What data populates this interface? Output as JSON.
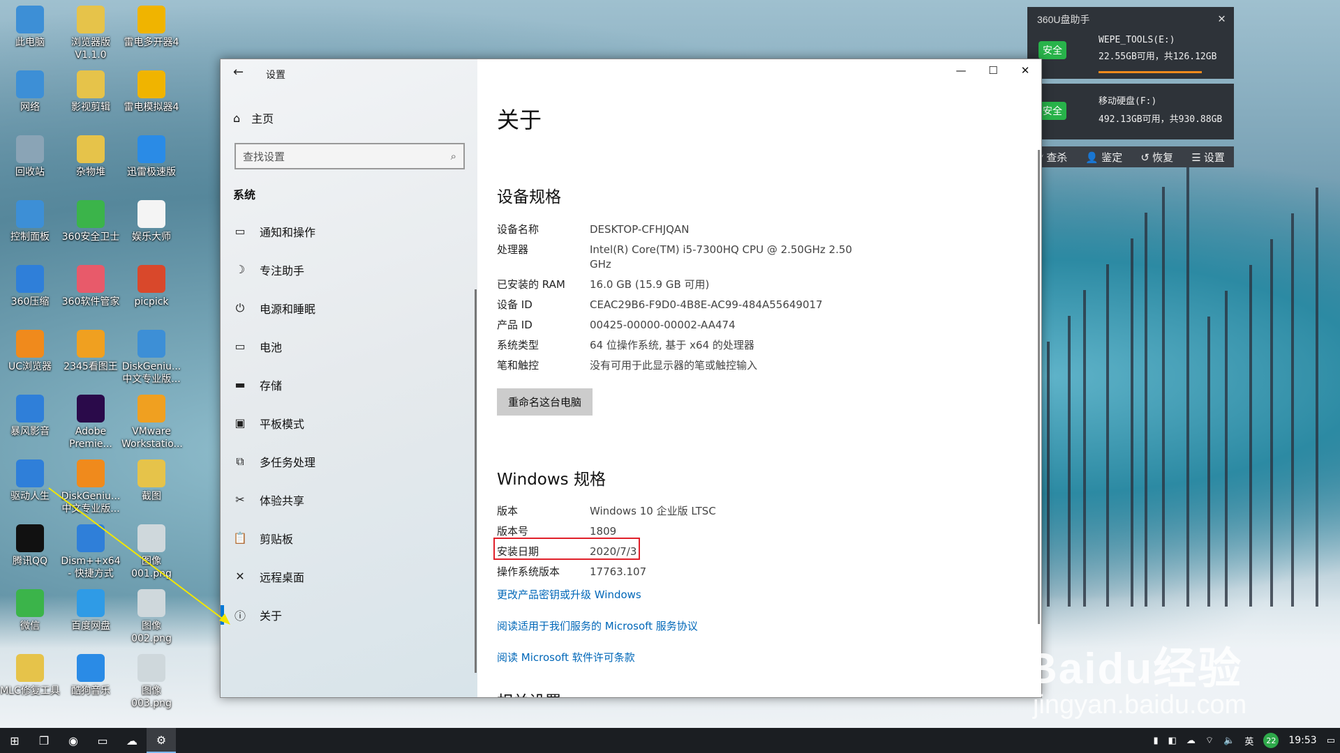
{
  "desktop_icons": [
    {
      "label": "此电脑",
      "icon": "computer-icon",
      "color": "#3d8fd6"
    },
    {
      "label": "浏览器版 V1.1.0",
      "icon": "file-icon",
      "color": "#e6c34a"
    },
    {
      "label": "雷电多开器4",
      "icon": "ldplayer-multi-icon",
      "color": "#f0b400"
    },
    {
      "label": "网络",
      "icon": "network-icon",
      "color": "#3d8fd6"
    },
    {
      "label": "影视剪辑",
      "icon": "folder-icon",
      "color": "#e6c34a"
    },
    {
      "label": "雷电模拟器4",
      "icon": "ldplayer-icon",
      "color": "#f0b400"
    },
    {
      "label": "回收站",
      "icon": "recycle-bin-icon",
      "color": "#8aa4b6"
    },
    {
      "label": "杂物堆",
      "icon": "file-icon",
      "color": "#e6c34a"
    },
    {
      "label": "迅雷极速版",
      "icon": "xunlei-icon",
      "color": "#2a8be6"
    },
    {
      "label": "控制面板",
      "icon": "control-panel-icon",
      "color": "#3d8fd6"
    },
    {
      "label": "360安全卫士",
      "icon": "360-safe-icon",
      "color": "#3bb44a"
    },
    {
      "label": "娱乐大师",
      "icon": "file-icon",
      "color": "#f4f4f4"
    },
    {
      "label": "360压缩",
      "icon": "360-zip-icon",
      "color": "#2f7fd9"
    },
    {
      "label": "360软件管家",
      "icon": "360-software-icon",
      "color": "#e85a6a"
    },
    {
      "label": "picpick",
      "icon": "picpick-icon",
      "color": "#d9482b"
    },
    {
      "label": "UC浏览器",
      "icon": "uc-browser-icon",
      "color": "#f08a1c"
    },
    {
      "label": "2345看图王",
      "icon": "2345-viewer-icon",
      "color": "#f0a020"
    },
    {
      "label": "DiskGeniu... 中文专业版...",
      "icon": "diskgenius-icon",
      "color": "#3d8fd6"
    },
    {
      "label": "暴风影音",
      "icon": "baofeng-icon",
      "color": "#2f7fd9"
    },
    {
      "label": "Adobe Premie...",
      "icon": "premiere-icon",
      "color": "#2a0a4a"
    },
    {
      "label": "VMware Workstatio...",
      "icon": "vmware-icon",
      "color": "#f0a020"
    },
    {
      "label": "驱动人生",
      "icon": "drive-life-icon",
      "color": "#2f7fd9"
    },
    {
      "label": "DiskGeniu... 中文专业版...",
      "icon": "diskgenius-icon",
      "color": "#f08a1c"
    },
    {
      "label": "截图",
      "icon": "folder-icon",
      "color": "#e6c34a"
    },
    {
      "label": "腾讯QQ",
      "icon": "qq-icon",
      "color": "#111111"
    },
    {
      "label": "Dism++x64 - 快捷方式",
      "icon": "dism-icon",
      "color": "#2f7fd9"
    },
    {
      "label": "图像 001.png",
      "icon": "image-file-icon",
      "color": "#cfd8dc"
    },
    {
      "label": "微信",
      "icon": "wechat-icon",
      "color": "#3bb44a"
    },
    {
      "label": "百度网盘",
      "icon": "baidu-pan-icon",
      "color": "#2f9be6"
    },
    {
      "label": "图像 002.png",
      "icon": "image-file-icon",
      "color": "#cfd8dc"
    },
    {
      "label": "MLC修复工具",
      "icon": "file-icon",
      "color": "#e6c34a"
    },
    {
      "label": "酷狗音乐",
      "icon": "kugou-icon",
      "color": "#2a8be6"
    },
    {
      "label": "图像 003.png",
      "icon": "image-file-icon",
      "color": "#cfd8dc"
    }
  ],
  "settings": {
    "app_title": "设置",
    "home_label": "主页",
    "search_placeholder": "查找设置",
    "section_label": "系统",
    "nav": [
      {
        "label": "通知和操作",
        "icon": "notification-icon"
      },
      {
        "label": "专注助手",
        "icon": "moon-icon"
      },
      {
        "label": "电源和睡眠",
        "icon": "power-icon"
      },
      {
        "label": "电池",
        "icon": "battery-icon"
      },
      {
        "label": "存储",
        "icon": "storage-icon"
      },
      {
        "label": "平板模式",
        "icon": "tablet-icon"
      },
      {
        "label": "多任务处理",
        "icon": "multitask-icon"
      },
      {
        "label": "体验共享",
        "icon": "share-icon"
      },
      {
        "label": "剪贴板",
        "icon": "clipboard-icon"
      },
      {
        "label": "远程桌面",
        "icon": "remote-desktop-icon"
      },
      {
        "label": "关于",
        "icon": "info-icon",
        "active": true
      }
    ],
    "page_title": "关于",
    "device_specs_title": "设备规格",
    "device_specs": [
      {
        "key": "设备名称",
        "value": "DESKTOP-CFHJQAN"
      },
      {
        "key": "处理器",
        "value": "Intel(R) Core(TM) i5-7300HQ CPU @ 2.50GHz   2.50 GHz"
      },
      {
        "key": "已安装的 RAM",
        "value": "16.0 GB (15.9 GB 可用)"
      },
      {
        "key": "设备 ID",
        "value": "CEAC29B6-F9D0-4B8E-AC99-484A55649017"
      },
      {
        "key": "产品 ID",
        "value": "00425-00000-00002-AA474"
      },
      {
        "key": "系统类型",
        "value": "64 位操作系统, 基于 x64 的处理器"
      },
      {
        "key": "笔和触控",
        "value": "没有可用于此显示器的笔或触控输入"
      }
    ],
    "rename_button": "重命名这台电脑",
    "windows_specs_title": "Windows 规格",
    "windows_specs": [
      {
        "key": "版本",
        "value": "Windows 10 企业版 LTSC"
      },
      {
        "key": "版本号",
        "value": "1809"
      },
      {
        "key": "安装日期",
        "value": "2020/7/3"
      },
      {
        "key": "操作系统版本",
        "value": "17763.107"
      }
    ],
    "links": [
      "更改产品密钥或升级 Windows",
      "阅读适用于我们服务的 Microsoft 服务协议",
      "阅读 Microsoft 软件许可条款"
    ],
    "cutoff_heading": "相关设置"
  },
  "widget360": {
    "title": "360U盘助手",
    "badge": "安全",
    "drive1_name": "WEPE_TOOLS(E:)",
    "drive1_space": "22.55GB可用，共126.12GB",
    "drive1_used_fraction": 0.82,
    "drive2_name": "移动硬盘(F:)",
    "drive2_space": "492.13GB可用，共930.88GB",
    "tools": [
      "查杀",
      "鉴定",
      "恢复",
      "设置"
    ]
  },
  "taskbar": {
    "time": "19:53",
    "ime": "英",
    "notification_count": "22"
  },
  "watermark": {
    "brand": "Baidu经验",
    "url": "jingyan.baidu.com"
  }
}
